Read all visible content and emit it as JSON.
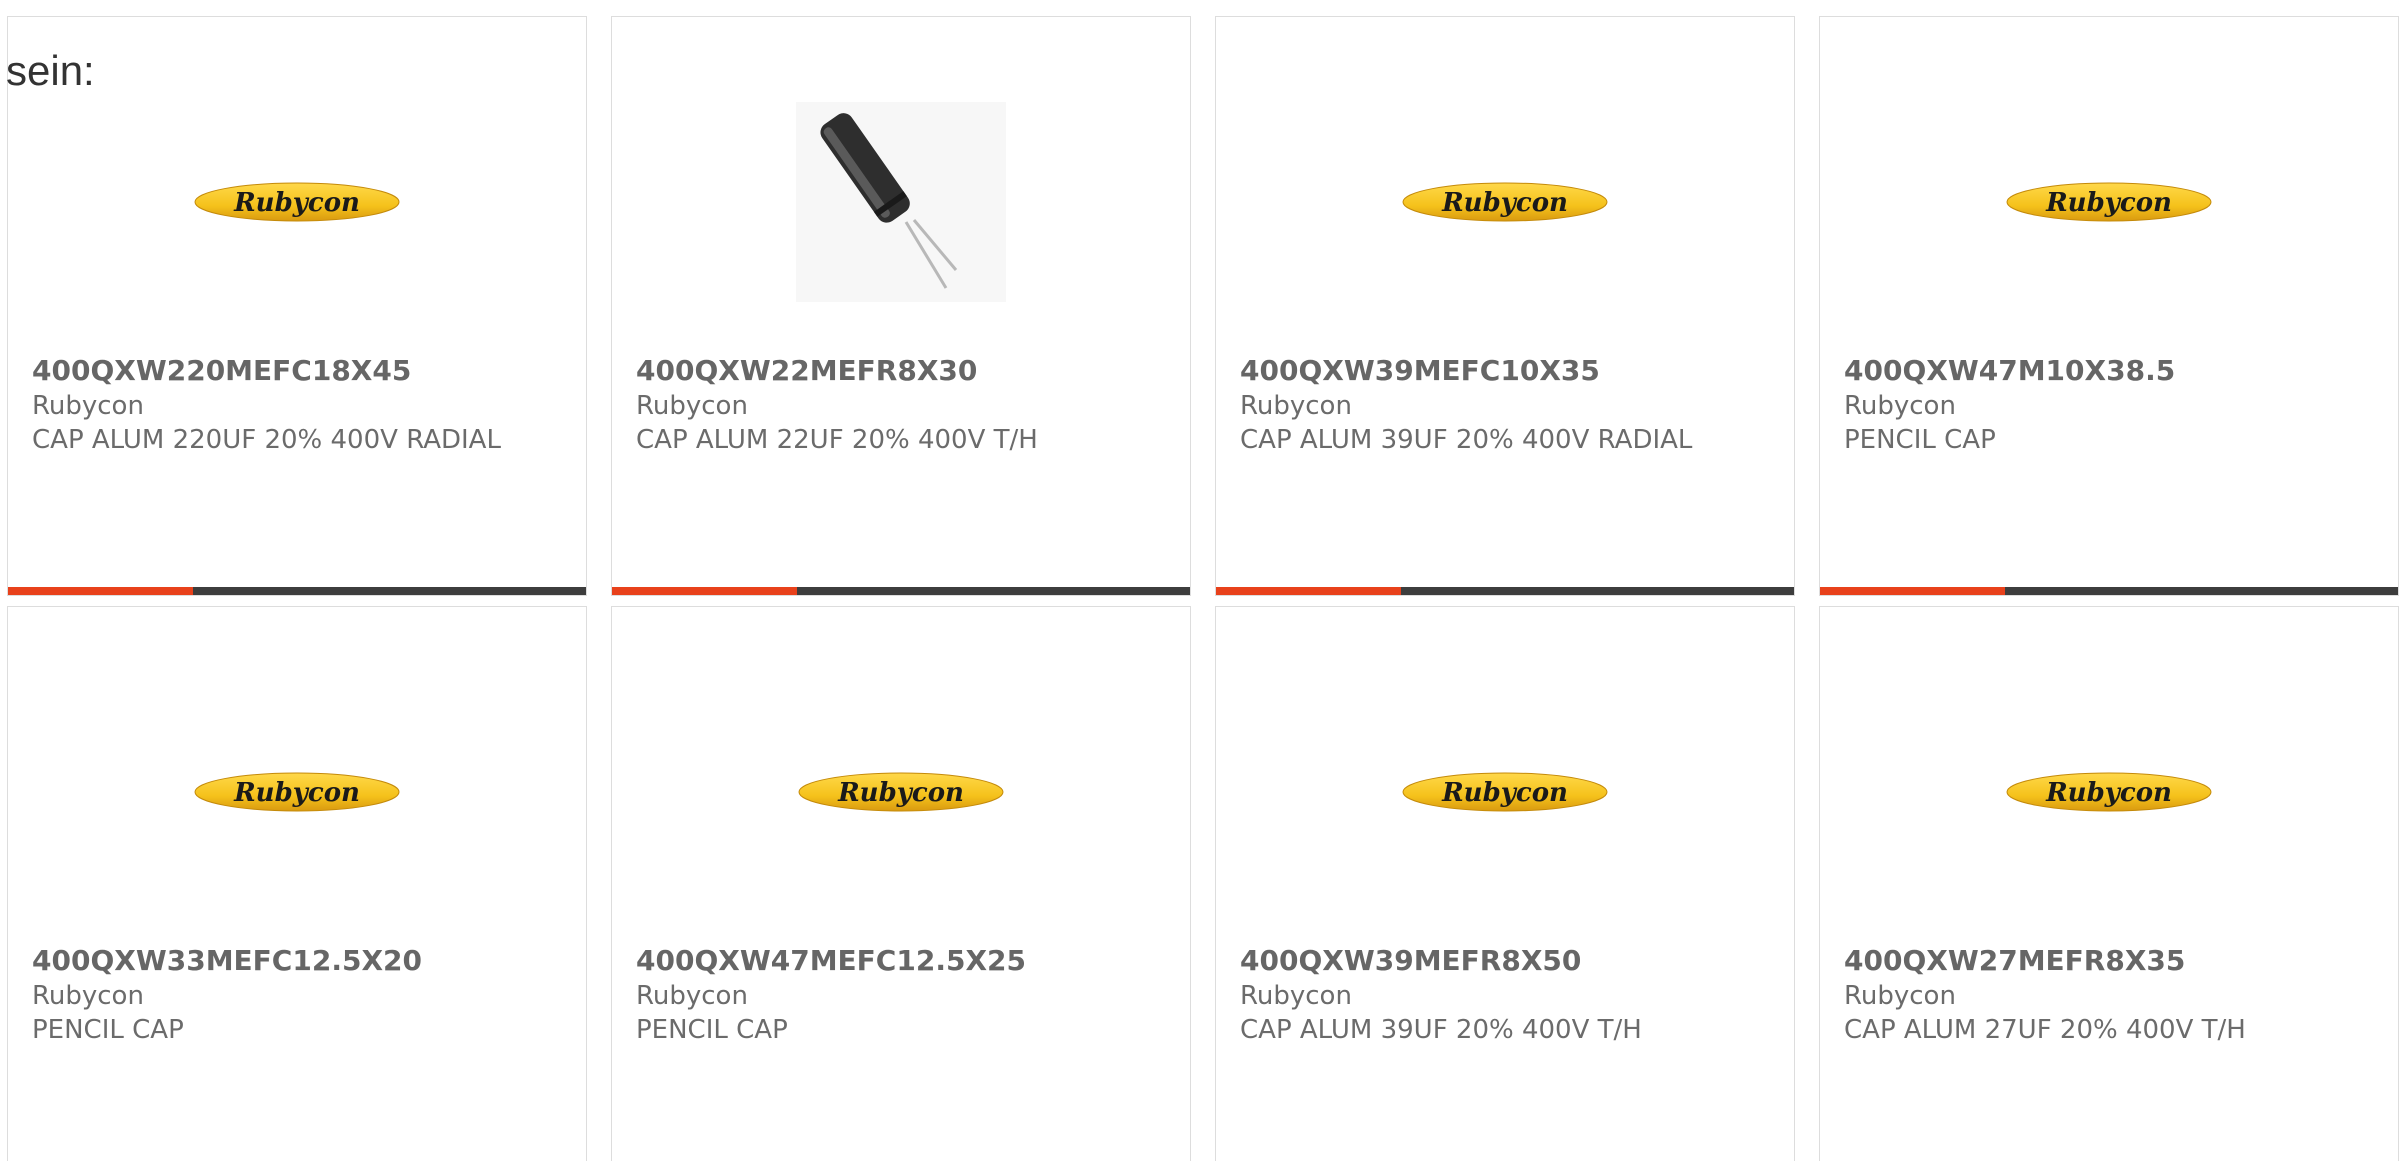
{
  "intro_text": "sein:",
  "colors": {
    "accent": "#e8411b",
    "bar": "#3d3d3d",
    "logo_fill": "#f5c21b",
    "border": "#dddddd",
    "text": "#6b6b6b"
  },
  "products": [
    {
      "part_number": "400QXW220MEFC18X45",
      "manufacturer": "Rubycon",
      "description": "CAP ALUM 220UF 20% 400V RADIAL",
      "image": "rubycon-logo",
      "logo_text": "Rubycon",
      "progress": 0.32
    },
    {
      "part_number": "400QXW22MEFR8X30",
      "manufacturer": "Rubycon",
      "description": "CAP ALUM 22UF 20% 400V T/H",
      "image": "capacitor-photo",
      "progress": 0.32
    },
    {
      "part_number": "400QXW39MEFC10X35",
      "manufacturer": "Rubycon",
      "description": "CAP ALUM 39UF 20% 400V RADIAL",
      "image": "rubycon-logo",
      "logo_text": "Rubycon",
      "progress": 0.32
    },
    {
      "part_number": "400QXW47M10X38.5",
      "manufacturer": "Rubycon",
      "description": "PENCIL CAP",
      "image": "rubycon-logo",
      "logo_text": "Rubycon",
      "progress": 0.32
    },
    {
      "part_number": "400QXW33MEFC12.5X20",
      "manufacturer": "Rubycon",
      "description": "PENCIL CAP",
      "image": "rubycon-logo",
      "logo_text": "Rubycon"
    },
    {
      "part_number": "400QXW47MEFC12.5X25",
      "manufacturer": "Rubycon",
      "description": "PENCIL CAP",
      "image": "rubycon-logo",
      "logo_text": "Rubycon"
    },
    {
      "part_number": "400QXW39MEFR8X50",
      "manufacturer": "Rubycon",
      "description": "CAP ALUM 39UF 20% 400V T/H",
      "image": "rubycon-logo",
      "logo_text": "Rubycon"
    },
    {
      "part_number": "400QXW27MEFR8X35",
      "manufacturer": "Rubycon",
      "description": "CAP ALUM 27UF 20% 400V T/H",
      "image": "rubycon-logo",
      "logo_text": "Rubycon"
    }
  ]
}
